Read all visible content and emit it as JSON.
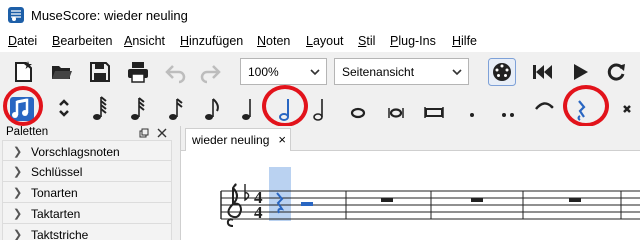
{
  "window": {
    "title": "MuseScore: wieder neuling"
  },
  "menu": [
    {
      "id": "datei",
      "underline": "D",
      "rest": "atei"
    },
    {
      "id": "bearbeiten",
      "underline": "B",
      "rest": "earbeiten"
    },
    {
      "id": "ansicht",
      "underline": "A",
      "rest": "nsicht"
    },
    {
      "id": "hinzufuegen",
      "underline": "H",
      "rest": "inzufügen"
    },
    {
      "id": "noten",
      "underline": "N",
      "rest": "oten"
    },
    {
      "id": "layout",
      "underline": "L",
      "rest": "ayout"
    },
    {
      "id": "stil",
      "underline": "S",
      "rest": "til"
    },
    {
      "id": "plugins",
      "underline": "P",
      "rest": "lug-Ins"
    },
    {
      "id": "hilfe",
      "underline": "H",
      "rest": "ilfe"
    }
  ],
  "toolbar": {
    "zoom_value": "100%",
    "view_mode": "Seitenansicht"
  },
  "palettes": {
    "title": "Paletten",
    "items": [
      "Vorschlagsnoten",
      "Schlüssel",
      "Tonarten",
      "Taktarten",
      "Taktstriche"
    ]
  },
  "score": {
    "tab_label": "wieder neuling",
    "tab_close": "×",
    "time_signature_top": "4",
    "time_signature_bottom": "4"
  },
  "colors": {
    "accent": "#2966c2",
    "highlight_circle": "#e2131b",
    "selection": "#a9c7ee"
  }
}
